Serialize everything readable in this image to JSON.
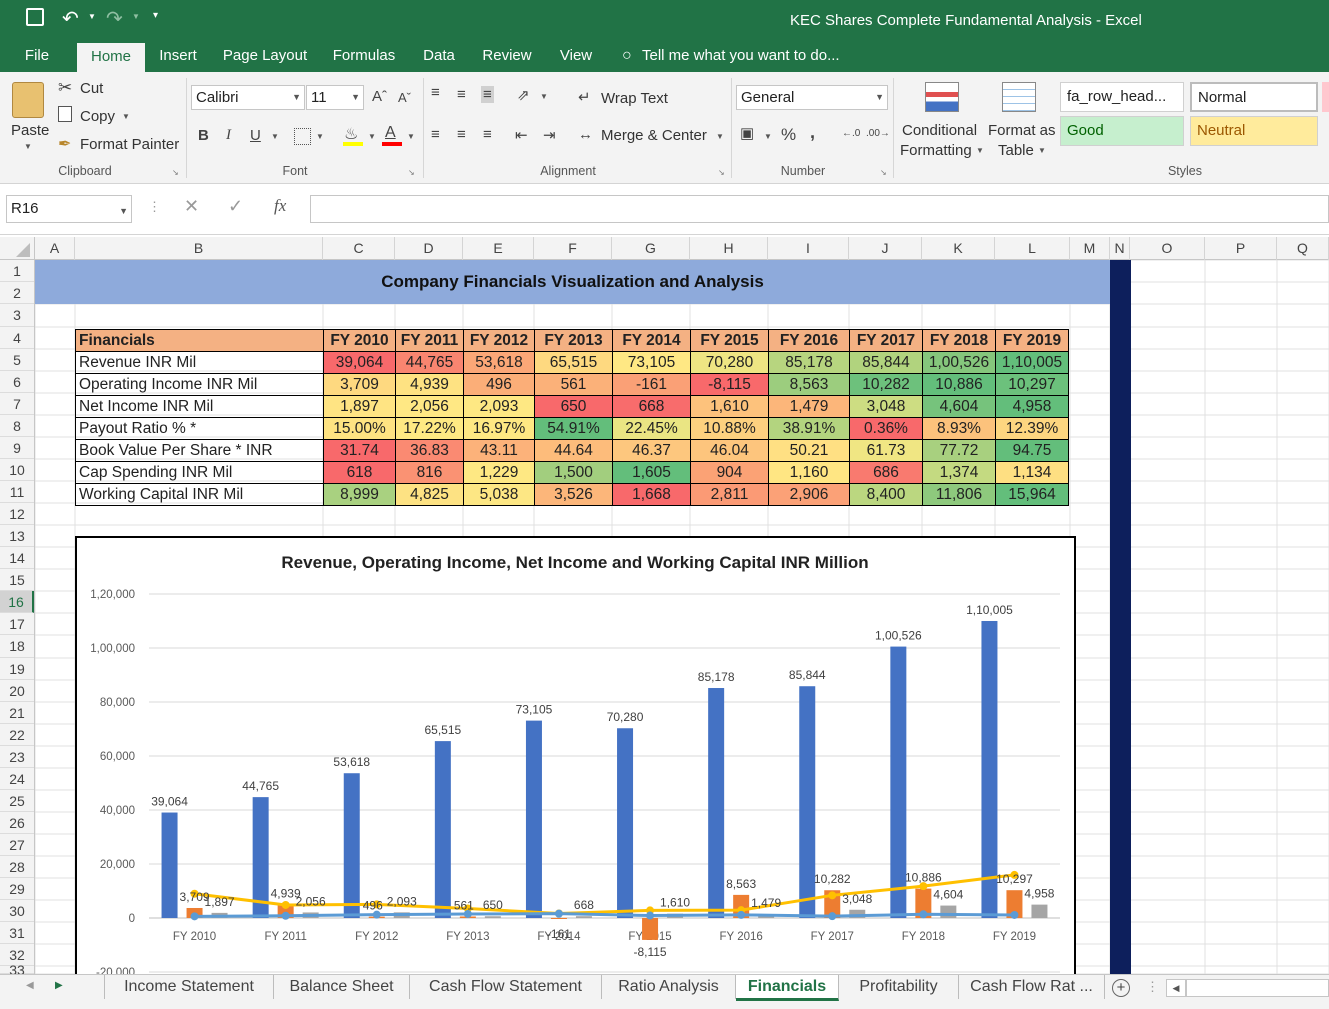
{
  "window": {
    "title": "KEC Shares Complete Fundamental Analysis - Excel"
  },
  "ribbon_tabs": [
    "File",
    "Home",
    "Insert",
    "Page Layout",
    "Formulas",
    "Data",
    "Review",
    "View"
  ],
  "tell_me": "Tell me what you want to do...",
  "clipboard": {
    "paste": "Paste",
    "cut": "Cut",
    "copy": "Copy",
    "format_painter": "Format Painter",
    "label": "Clipboard"
  },
  "font": {
    "name": "Calibri",
    "size": "11",
    "bold": "B",
    "italic": "I",
    "underline": "U",
    "label": "Font"
  },
  "alignment": {
    "wrap": "Wrap Text",
    "merge": "Merge & Center",
    "label": "Alignment"
  },
  "number": {
    "format": "General",
    "percent": "%",
    "comma": ",",
    "label": "Number"
  },
  "styles": {
    "conditional": "Conditional",
    "conditional2": "Formatting",
    "format_as": "Format as",
    "format_as2": "Table",
    "fa_row": "fa_row_head...",
    "normal": "Normal",
    "good": "Good",
    "neutral": "Neutral",
    "label": "Styles"
  },
  "formula_bar": {
    "name_box": "R16",
    "fx": "fx",
    "content": ""
  },
  "columns": [
    "A",
    "B",
    "C",
    "D",
    "E",
    "F",
    "G",
    "H",
    "I",
    "J",
    "K",
    "L",
    "M",
    "N",
    "O",
    "P",
    "Q"
  ],
  "rows": [
    "1",
    "2",
    "3",
    "4",
    "5",
    "6",
    "7",
    "8",
    "9",
    "10",
    "11",
    "12",
    "13",
    "14",
    "15",
    "16",
    "17",
    "18",
    "19",
    "20",
    "21",
    "22",
    "23",
    "24",
    "25",
    "26",
    "27",
    "28",
    "29",
    "30",
    "31",
    "32",
    "33"
  ],
  "banner": "Company Financials Visualization and Analysis",
  "table": {
    "header": [
      "Financials",
      "FY 2010",
      "FY 2011",
      "FY 2012",
      "FY 2013",
      "FY 2014",
      "FY 2015",
      "FY 2016",
      "FY 2017",
      "FY 2018",
      "FY 2019"
    ],
    "rows": [
      {
        "label": "Revenue INR Mil",
        "values": [
          "39,064",
          "44,765",
          "53,618",
          "65,515",
          "73,105",
          "70,280",
          "85,178",
          "85,844",
          "1,00,526",
          "1,10,005"
        ],
        "colors": [
          "#f8696b",
          "#f98570",
          "#fba777",
          "#fed980",
          "#ffe884",
          "#eee583",
          "#b7d57f",
          "#b1d37e",
          "#85c67c",
          "#63be7b"
        ]
      },
      {
        "label": "Operating Income INR Mil",
        "values": [
          "3,709",
          "4,939",
          "496",
          "561",
          "-161",
          "-8,115",
          "8,563",
          "10,282",
          "10,886",
          "10,297"
        ],
        "colors": [
          "#fed980",
          "#fee282",
          "#fbae78",
          "#fbb179",
          "#faa076",
          "#f8696b",
          "#9ccd7e",
          "#6dc17c",
          "#63be7b",
          "#6cc17c"
        ]
      },
      {
        "label": "Net Income INR Mil",
        "values": [
          "1,897",
          "2,056",
          "2,093",
          "650",
          "668",
          "1,610",
          "1,479",
          "3,048",
          "4,604",
          "4,958"
        ],
        "colors": [
          "#ffe483",
          "#ffe884",
          "#fee883",
          "#f8696b",
          "#f86c6c",
          "#fdc27c",
          "#fcb67a",
          "#cddd82",
          "#76c37c",
          "#63be7b"
        ]
      },
      {
        "label": "Payout Ratio % *",
        "values": [
          "15.00%",
          "17.22%",
          "16.97%",
          "54.91%",
          "22.45%",
          "10.88%",
          "38.91%",
          "0.36%",
          "8.93%",
          "12.39%"
        ],
        "colors": [
          "#fee382",
          "#fee983",
          "#fee883",
          "#63be7b",
          "#eae583",
          "#fdd17f",
          "#b3d47f",
          "#f8696b",
          "#fcc27c",
          "#fdd680"
        ]
      },
      {
        "label": "Book Value Per Share * INR",
        "values": [
          "31.74",
          "36.83",
          "43.11",
          "44.64",
          "46.37",
          "46.04",
          "50.21",
          "61.73",
          "77.72",
          "94.75"
        ],
        "colors": [
          "#f8696b",
          "#fa8a72",
          "#fcb27a",
          "#fdbc7b",
          "#fdc77e",
          "#fdc57d",
          "#ffe083",
          "#f0e683",
          "#a8d07f",
          "#63be7b"
        ]
      },
      {
        "label": "Cap Spending INR Mil",
        "values": [
          "618",
          "816",
          "1,229",
          "1,500",
          "1,605",
          "904",
          "1,160",
          "686",
          "1,374",
          "1,134"
        ],
        "colors": [
          "#f8696b",
          "#fa9273",
          "#fee883",
          "#a2ce7e",
          "#63be7b",
          "#fba275",
          "#ffe683",
          "#f97a6f",
          "#c4da81",
          "#fedf82"
        ]
      },
      {
        "label": "Working Capital INR Mil",
        "values": [
          "8,999",
          "4,825",
          "5,038",
          "3,526",
          "1,668",
          "2,811",
          "2,906",
          "8,400",
          "11,806",
          "15,964"
        ],
        "colors": [
          "#a9d180",
          "#fde283",
          "#fde784",
          "#fcb67a",
          "#f8696b",
          "#fb9a75",
          "#fba177",
          "#bbd780",
          "#8ec97d",
          "#63be7b"
        ]
      }
    ]
  },
  "chart_data": {
    "type": "bar",
    "title": "Revenue, Operating Income, Net Income and Working Capital INR Million",
    "categories": [
      "FY 2010",
      "FY 2011",
      "FY 2012",
      "FY 2013",
      "FY 2014",
      "FY 2015",
      "FY 2016",
      "FY 2017",
      "FY 2018",
      "FY 2019"
    ],
    "yticks": [
      "1,20,000",
      "1,00,000",
      "80,000",
      "60,000",
      "40,000",
      "20,000",
      "0",
      "-20,000"
    ],
    "ylim": [
      -20000,
      120000
    ],
    "series": [
      {
        "values": [
          39064,
          44765,
          53618,
          65515,
          73105,
          70280,
          85178,
          85844,
          100526,
          110005
        ],
        "labels": [
          "39,064",
          "44,765",
          "53,618",
          "65,515",
          "73,105",
          "70,280",
          "85,178",
          "85,844",
          "1,00,526",
          "1,10,005"
        ],
        "color": "#4472c4",
        "kind": "bar"
      },
      {
        "values": [
          3709,
          4939,
          496,
          561,
          -161,
          -8115,
          8563,
          10282,
          10886,
          10297
        ],
        "labels": [
          "3,709",
          "4,939",
          "496",
          "561",
          "-161",
          "-8,115",
          "8,563",
          "10,282",
          "10,886",
          "10,297"
        ],
        "color": "#ed7d31",
        "kind": "bar"
      },
      {
        "values": [
          1897,
          2056,
          2093,
          650,
          668,
          1610,
          1479,
          3048,
          4604,
          4958
        ],
        "labels": [
          "1,897",
          "2,056",
          "2,093",
          "650",
          "668",
          "1,610",
          "1,479",
          "3,048",
          "4,604",
          "4,958"
        ],
        "color": "#a5a5a5",
        "kind": "bar"
      },
      {
        "values": [
          8999,
          4825,
          5038,
          3526,
          1668,
          2811,
          2906,
          8400,
          11806,
          15964
        ],
        "color": "#ffc000",
        "kind": "line"
      },
      {
        "values": [
          618,
          816,
          1229,
          1500,
          1605,
          904,
          1160,
          686,
          1374,
          1134
        ],
        "color": "#5b9bd5",
        "kind": "line"
      }
    ],
    "legend": "none"
  },
  "sheet_tabs": [
    "Income Statement",
    "Balance Sheet",
    "Cash Flow Statement",
    "Ratio Analysis",
    "Financials",
    "Profitability",
    "Cash Flow Rat ..."
  ]
}
